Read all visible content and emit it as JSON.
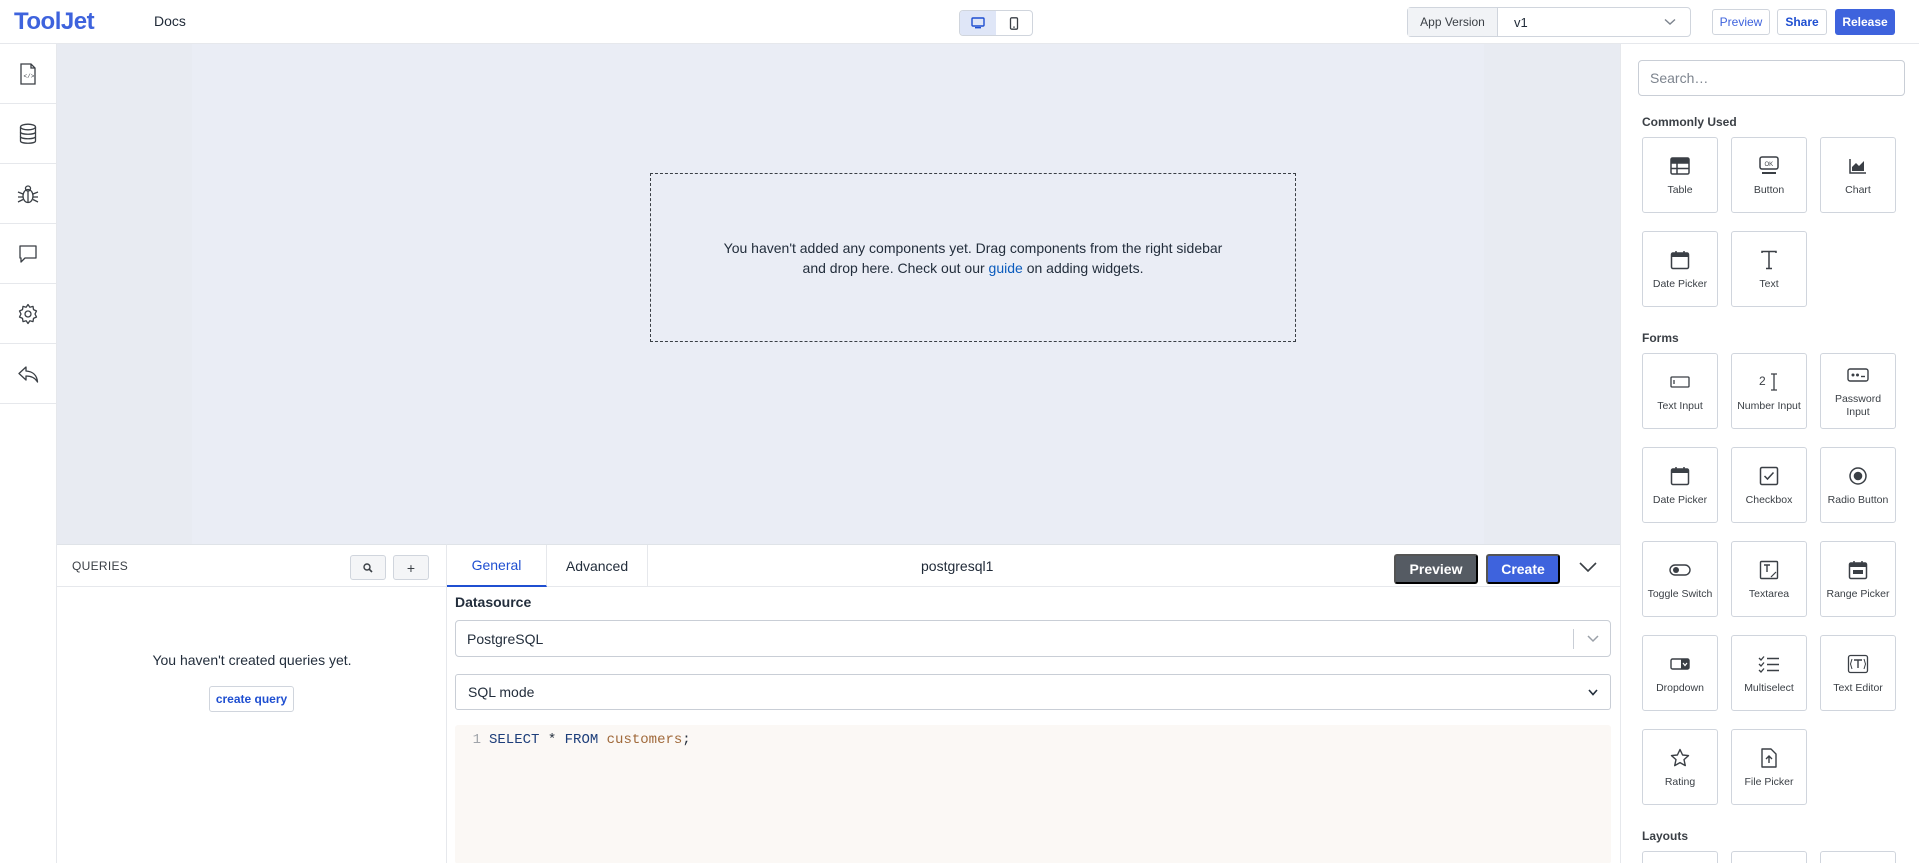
{
  "header": {
    "logo_text": "ToolJet",
    "app_name": "Docs",
    "layout_toggle": {
      "desktop_icon": "desktop-icon",
      "mobile_icon": "mobile-icon",
      "active": "desktop"
    },
    "app_version_label": "App Version",
    "app_version_value": "v1",
    "preview_label": "Preview",
    "share_label": "Share",
    "release_label": "Release"
  },
  "left_sidebar": {
    "items": [
      {
        "name": "pages-icon"
      },
      {
        "name": "database-icon"
      },
      {
        "name": "debugger-icon"
      },
      {
        "name": "comments-icon"
      },
      {
        "name": "settings-icon"
      },
      {
        "name": "back-icon"
      }
    ]
  },
  "canvas": {
    "empty_line1": "You haven't added any components yet. Drag components from the right sidebar",
    "empty_line2_pre": "and drop here. Check out our ",
    "empty_link": "guide",
    "empty_line2_post": " on adding widgets."
  },
  "queries": {
    "title": "QUERIES",
    "search_icon": "search-icon",
    "add_label": "+",
    "empty_text": "You haven't created queries yet.",
    "create_label": "create query"
  },
  "editor": {
    "tabs": [
      {
        "label": "General",
        "active": true
      },
      {
        "label": "Advanced",
        "active": false
      }
    ],
    "query_name": "postgresql1",
    "preview_label": "Preview",
    "create_label": "Create",
    "datasource_label": "Datasource",
    "datasource_value": "PostgreSQL",
    "mode_value": "SQL mode",
    "code": {
      "line_number": "1",
      "kw1": "SELECT",
      "op": " * ",
      "kw2": "FROM",
      "table": "customers",
      "end": ";"
    }
  },
  "right_sidebar": {
    "search_placeholder": "Search…",
    "sections": {
      "common": "Commonly Used",
      "forms": "Forms",
      "layouts": "Layouts"
    },
    "common_widgets": [
      {
        "label": "Table",
        "icon": "table-icon"
      },
      {
        "label": "Button",
        "icon": "button-icon"
      },
      {
        "label": "Chart",
        "icon": "chart-icon"
      },
      {
        "label": "Date Picker",
        "icon": "calendar-icon"
      },
      {
        "label": "Text",
        "icon": "text-icon"
      }
    ],
    "form_widgets": [
      {
        "label": "Text Input",
        "icon": "text-input-icon"
      },
      {
        "label": "Number Input",
        "icon": "number-input-icon"
      },
      {
        "label": "Password Input",
        "icon": "password-input-icon"
      },
      {
        "label": "Date Picker",
        "icon": "calendar-icon"
      },
      {
        "label": "Checkbox",
        "icon": "checkbox-icon"
      },
      {
        "label": "Radio Button",
        "icon": "radio-icon"
      },
      {
        "label": "Toggle Switch",
        "icon": "toggle-icon"
      },
      {
        "label": "Textarea",
        "icon": "textarea-icon"
      },
      {
        "label": "Range Picker",
        "icon": "range-picker-icon"
      },
      {
        "label": "Dropdown",
        "icon": "dropdown-icon"
      },
      {
        "label": "Multiselect",
        "icon": "multiselect-icon"
      },
      {
        "label": "Text Editor",
        "icon": "text-editor-icon"
      },
      {
        "label": "Rating",
        "icon": "star-icon"
      },
      {
        "label": "File Picker",
        "icon": "file-picker-icon"
      }
    ]
  }
}
